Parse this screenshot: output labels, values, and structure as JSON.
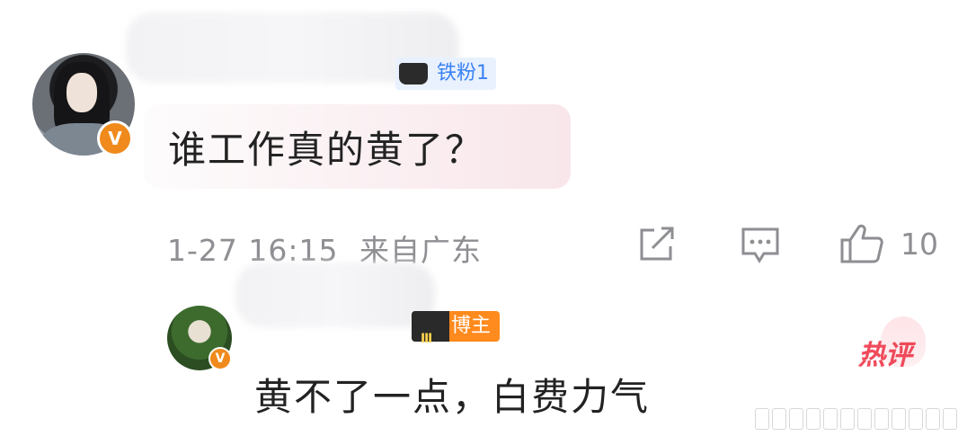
{
  "comment": {
    "fan_badge": "铁粉1",
    "text": "谁工作真的黄了？",
    "time": "1-27 16:15",
    "location": "来自广东",
    "like_count": "10",
    "icons": [
      "share-icon",
      "comment-icon",
      "like-icon"
    ]
  },
  "reply": {
    "badge": "博主",
    "badge_level": "Ⅲ",
    "text": "黄不了一点，白费力气",
    "hot_label": "热评"
  },
  "colors": {
    "vip_orange": "#f08a1c",
    "fan_badge_blue": "#3b82f6",
    "blogger_orange": "#ff8a1d",
    "hot_red": "#ef4a5a",
    "meta_gray": "#8e8e93"
  }
}
